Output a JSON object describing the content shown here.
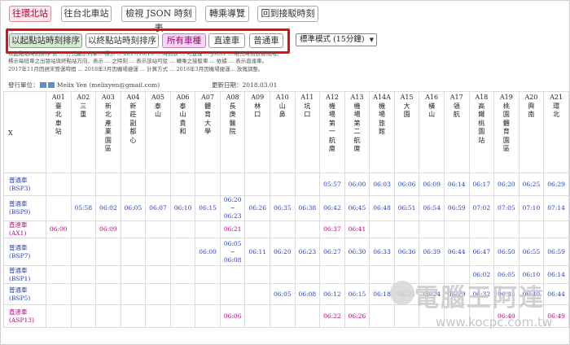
{
  "top_buttons": [
    "往環北站",
    "往台北車站",
    "檢視 JSON 時刻表",
    "轉乘導覽",
    "回到接駁時刻"
  ],
  "sort_buttons": [
    "以起點站時刻排序",
    "以終點站時刻排序",
    "所有車種",
    "直達車",
    "普通車"
  ],
  "mode_select": {
    "value": "標準模式 (15分鐘)"
  },
  "notes": [
    "以起點站時刻排序 依 ... 方式顯示列車... 標示 ... 2017/10/16 ... 時刻表 ... 可直接 ... JSON ... 格式時刻表檢視用。",
    "標示每班車之出發站與終點站方向，表示 ... 之時刻 ... 表示該站可從 ... 轉乘之接駁車 ... 依據 ... 表示直達車。",
    "2017年11月因週末營運時間 ... 2018年3月因機場捷運 ... 計算方式 ... 2018年3月因機場捷運... 放寬調整。"
  ],
  "publisher": {
    "label": "發行單位：",
    "name": "Melix Yen (melixyen@gmail.com)"
  },
  "updated": "更新日期：2018.03.01",
  "table": {
    "corner": "X",
    "stations": [
      {
        "code": "A01",
        "name": "臺北車站"
      },
      {
        "code": "A02",
        "name": "三重"
      },
      {
        "code": "A03",
        "name": "新北產業園區"
      },
      {
        "code": "A04",
        "name": "新莊副都心"
      },
      {
        "code": "A05",
        "name": "泰山"
      },
      {
        "code": "A06",
        "name": "泰山貴和"
      },
      {
        "code": "A07",
        "name": "體育大學"
      },
      {
        "code": "A08",
        "name": "長庚醫院"
      },
      {
        "code": "A09",
        "name": "林口"
      },
      {
        "code": "A10",
        "name": "山鼻"
      },
      {
        "code": "A11",
        "name": "坑口"
      },
      {
        "code": "A12",
        "name": "機場第一航廈"
      },
      {
        "code": "A13",
        "name": "機場第二航廈"
      },
      {
        "code": "A14A",
        "name": "機場旅館"
      },
      {
        "code": "A15",
        "name": "大園"
      },
      {
        "code": "A16",
        "name": "橫山"
      },
      {
        "code": "A17",
        "name": "領航"
      },
      {
        "code": "A18",
        "name": "高鐵桃園站"
      },
      {
        "code": "A19",
        "name": "桃園體育園區"
      },
      {
        "code": "A20",
        "name": "興南"
      },
      {
        "code": "A21",
        "name": "環北"
      }
    ],
    "rows": [
      {
        "type": "普通車",
        "id": "(BSP3)",
        "kind": "reg",
        "times": [
          "",
          "",
          "",
          "",
          "",
          "",
          "",
          "",
          "",
          "",
          "",
          "05:57",
          "06:00",
          "06:03",
          "06:06",
          "06:09",
          "06:14",
          "06:17",
          "06:20",
          "06:25",
          "06:29"
        ]
      },
      {
        "type": "普通車",
        "id": "(BSP9)",
        "kind": "reg",
        "times": [
          "",
          "05:58",
          "06:02",
          "06:05",
          "06:07",
          "06:10",
          "06:15",
          "06:20 ~ 06:23",
          "06:26",
          "06:35",
          "06:38",
          "06:42",
          "06:45",
          "06:48",
          "06:51",
          "06:54",
          "06:59",
          "07:02",
          "07:05",
          "07:10",
          "07:14"
        ]
      },
      {
        "type": "直達車",
        "id": "(AX1)",
        "kind": "exp",
        "times": [
          "06:00",
          "",
          "06:09",
          "",
          "",
          "",
          "",
          "06:21",
          "",
          "",
          "",
          "06:37",
          "06:41",
          "",
          "",
          "",
          "",
          "",
          "",
          "",
          ""
        ]
      },
      {
        "type": "普通車",
        "id": "(BSP7)",
        "kind": "reg",
        "times": [
          "",
          "",
          "",
          "",
          "",
          "",
          "06:00",
          "06:05 ~ 06:08",
          "06:11",
          "06:20",
          "06:23",
          "06:27",
          "06:30",
          "06:33",
          "06:36",
          "06:39",
          "06:44",
          "06:47",
          "06:50",
          "06:55",
          "06:59"
        ]
      },
      {
        "type": "普通車",
        "id": "(BSP1)",
        "kind": "reg",
        "times": [
          "",
          "",
          "",
          "",
          "",
          "",
          "",
          "",
          "",
          "",
          "",
          "",
          "",
          "",
          "",
          "",
          "",
          "06:02",
          "06:05",
          "06:10",
          "06:14"
        ]
      },
      {
        "type": "普通車",
        "id": "(BSP5)",
        "kind": "reg",
        "times": [
          "",
          "",
          "",
          "",
          "",
          "",
          "",
          "",
          "",
          "06:05",
          "06:08",
          "06:12",
          "06:15",
          "06:18",
          "06:21",
          "06:24",
          "06:29",
          "06:32",
          "06:35",
          "06:40",
          "06:44"
        ]
      },
      {
        "type": "直達車",
        "id": "(ASP13)",
        "kind": "exp",
        "times": [
          "",
          "",
          "",
          "",
          "",
          "",
          "",
          "06:06",
          "",
          "",
          "",
          "06:22",
          "06:26",
          "",
          "",
          "",
          "",
          "",
          "06:40",
          "",
          "06:49"
        ]
      }
    ]
  },
  "watermark": {
    "big": "電腦王阿達",
    "url": "www.kocpc.com.tw"
  }
}
